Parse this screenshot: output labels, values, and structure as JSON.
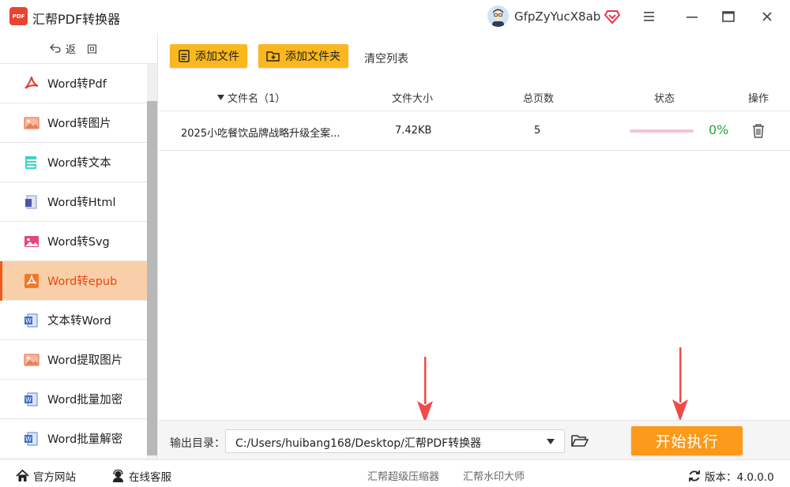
{
  "app": {
    "title": "汇帮PDF转换器",
    "logo_text": "PDF",
    "user_name": "GfpZyYucX8ab"
  },
  "sidebar": {
    "back_label": "返回",
    "items": [
      {
        "label": "Word转Pdf",
        "icon": "pdf-icon",
        "active": false
      },
      {
        "label": "Word转图片",
        "icon": "image-icon",
        "active": false
      },
      {
        "label": "Word转文本",
        "icon": "text-file-icon",
        "active": false
      },
      {
        "label": "Word转Html",
        "icon": "html-file-icon",
        "active": false
      },
      {
        "label": "Word转Svg",
        "icon": "svg-image-icon",
        "active": false
      },
      {
        "label": "Word转epub",
        "icon": "epub-icon",
        "active": true
      },
      {
        "label": "文本转Word",
        "icon": "word-icon",
        "active": false
      },
      {
        "label": "Word提取图片",
        "icon": "image-icon",
        "active": false
      },
      {
        "label": "Word批量加密",
        "icon": "word-icon",
        "active": false
      },
      {
        "label": "Word批量解密",
        "icon": "word-icon",
        "active": false
      }
    ]
  },
  "toolbar": {
    "add_file_label": "添加文件",
    "add_folder_label": "添加文件夹",
    "clear_label": "清空列表"
  },
  "table": {
    "headers": {
      "filename": "文件名（1）",
      "size": "文件大小",
      "pages": "总页数",
      "status": "状态",
      "actions": "操作"
    },
    "rows": [
      {
        "filename": "2025小吃餐饮品牌战略升级全案...",
        "size": "7.42KB",
        "pages": "5",
        "progress": 0,
        "progress_label": "0%"
      }
    ]
  },
  "output": {
    "label": "输出目录：",
    "path": "C:/Users/huibang168/Desktop/汇帮PDF转换器",
    "start_label": "开始执行"
  },
  "statusbar": {
    "website_label": "官方网站",
    "support_label": "在线客服",
    "link1": "汇帮超级压缩器",
    "link2": "汇帮水印大师",
    "version_label": "版本：4.0.0.0"
  },
  "colors": {
    "accent": "#fbb81e",
    "start": "#fb9a1a",
    "active_bg": "#f9cfa9",
    "active_text": "#e8470f",
    "progress_ok": "#2aa33a",
    "arrow": "#ef4b4b"
  }
}
